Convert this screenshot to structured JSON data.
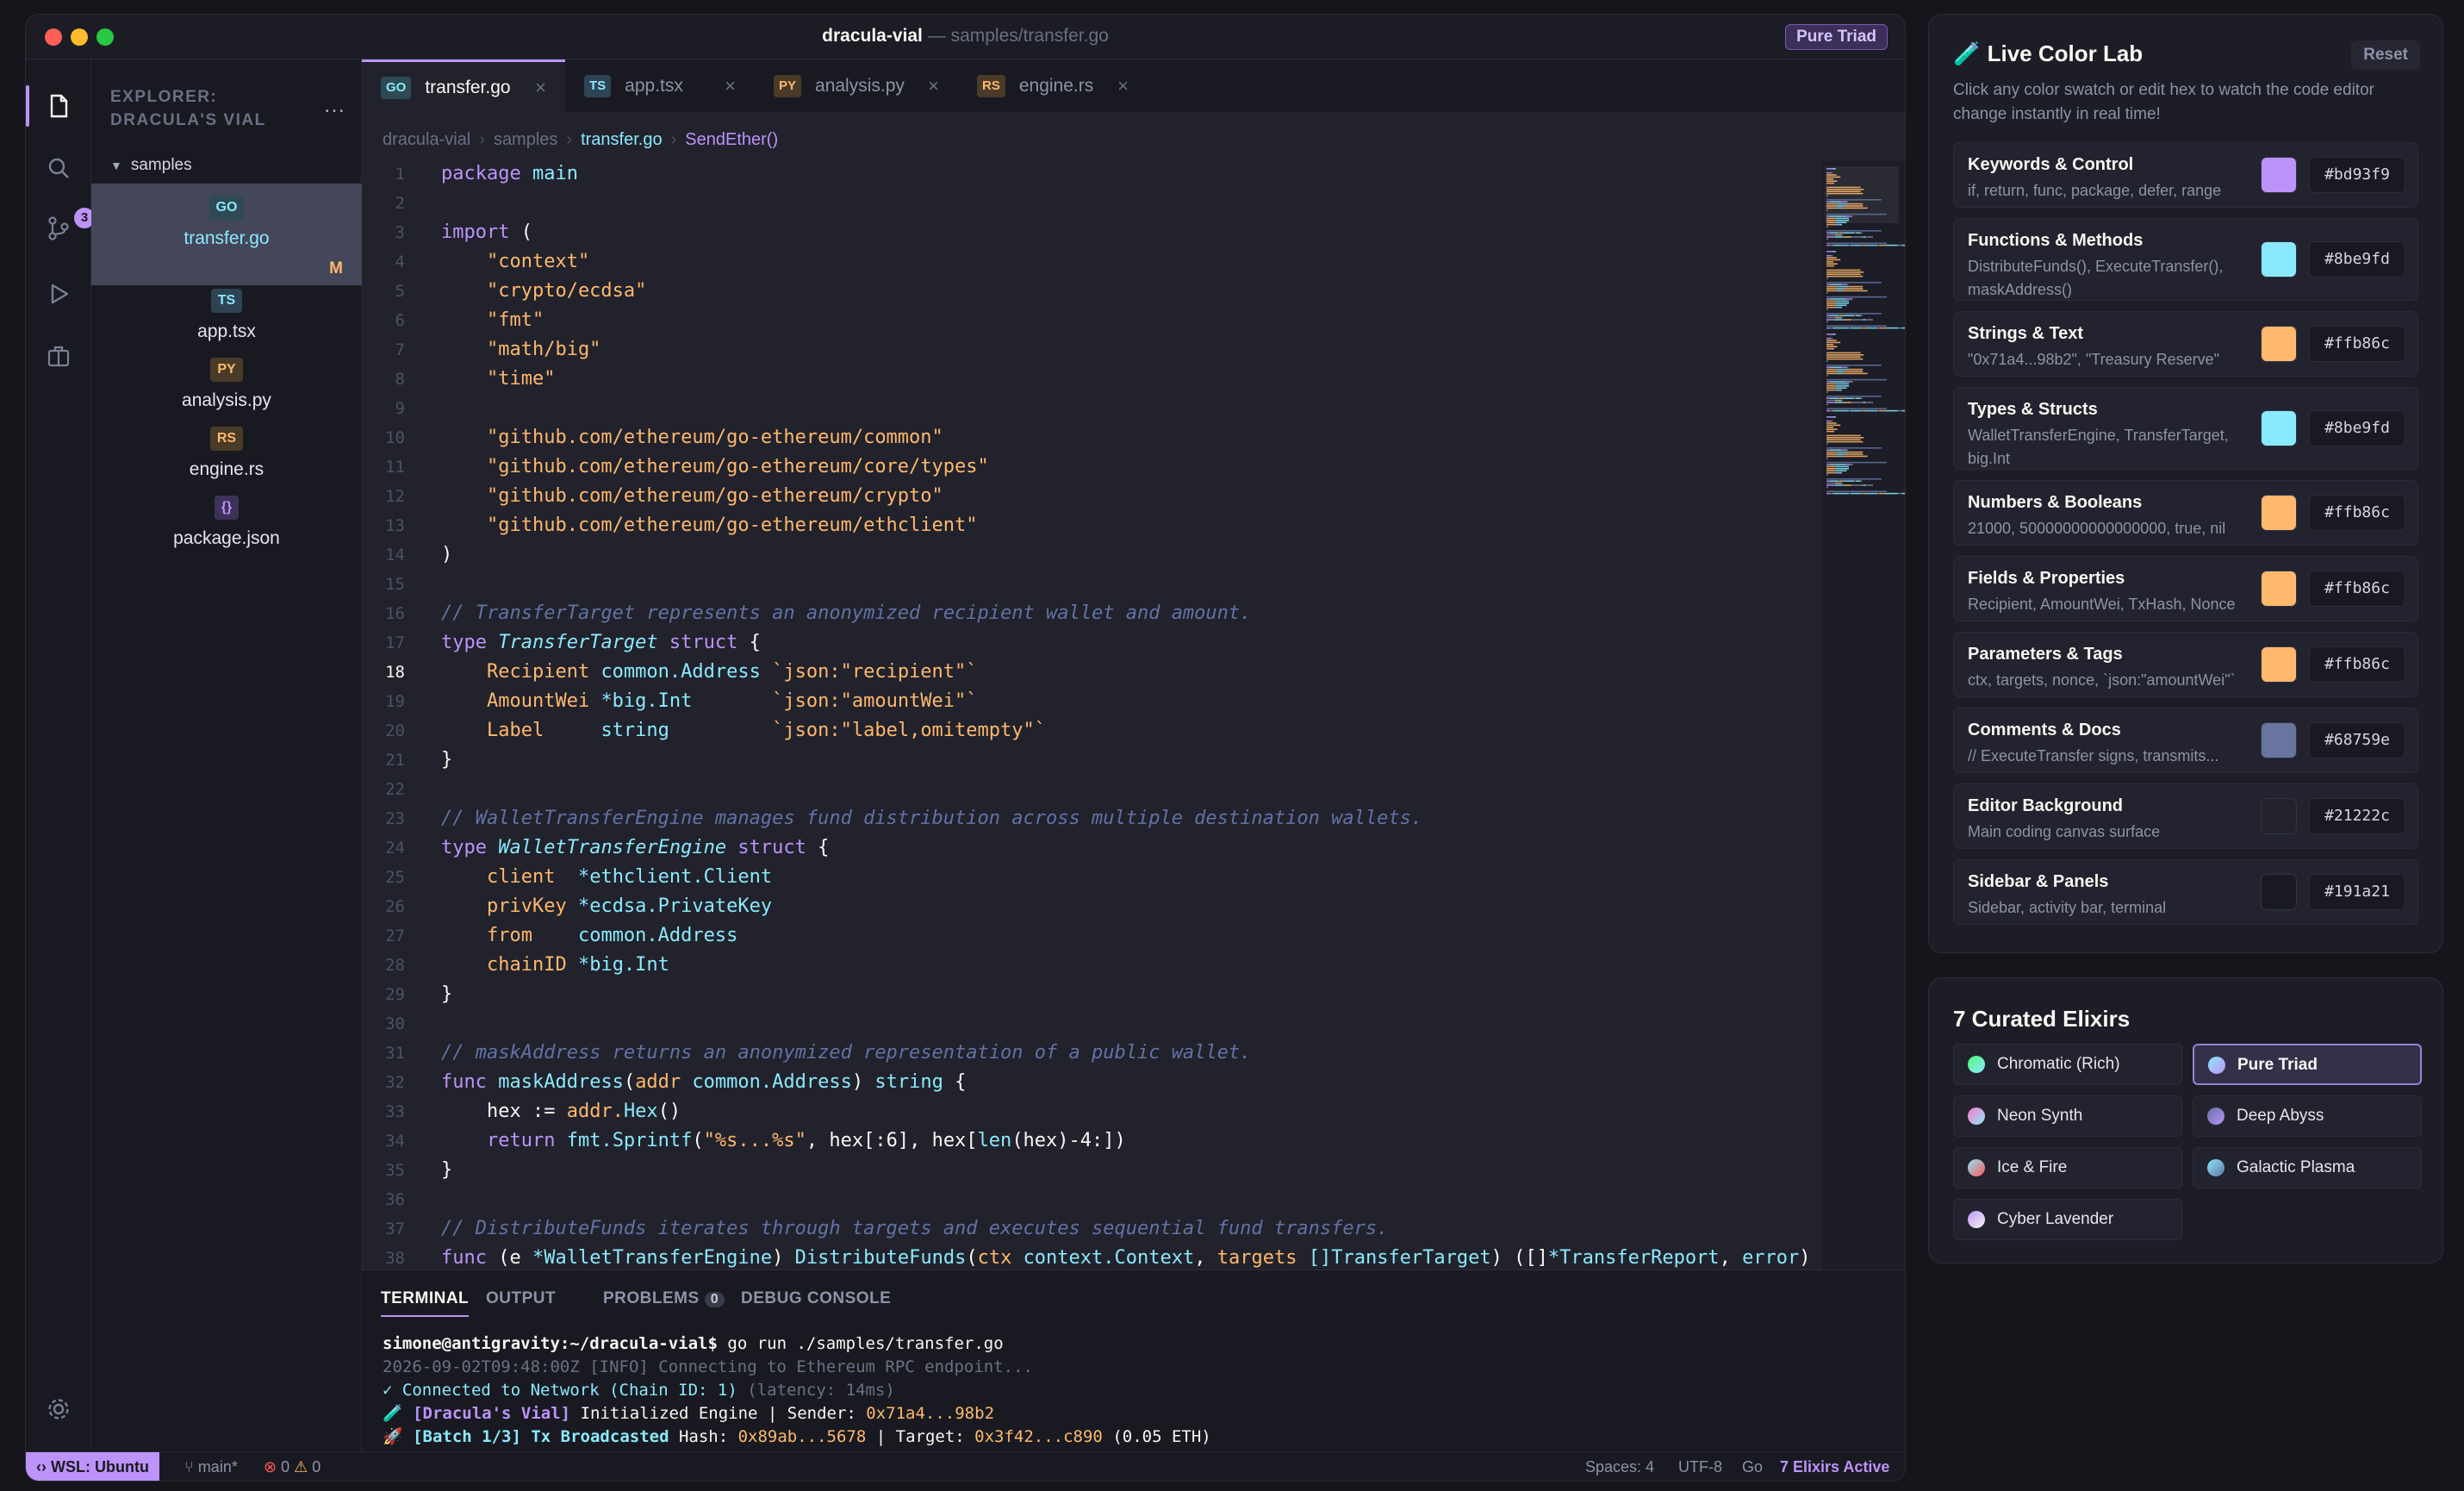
{
  "window": {
    "app": "dracula-vial",
    "sep": " — ",
    "path": "samples/transfer.go",
    "theme_badge": "Pure Triad"
  },
  "activity": {
    "scm_count": "3"
  },
  "explorer": {
    "title": "EXPLORER: DRACULA'S VIAL",
    "more": "…",
    "folder": "samples",
    "files": [
      {
        "badge": "GO",
        "name": "transfer.go",
        "modified": "M"
      },
      {
        "badge": "TS",
        "name": "app.tsx"
      },
      {
        "badge": "PY",
        "name": "analysis.py"
      },
      {
        "badge": "RS",
        "name": "engine.rs"
      },
      {
        "badge": "{}",
        "name": "package.json"
      }
    ]
  },
  "tabs": [
    {
      "badge": "GO",
      "label": "transfer.go"
    },
    {
      "badge": "TS",
      "label": "app.tsx"
    },
    {
      "badge": "PY",
      "label": "analysis.py"
    },
    {
      "badge": "RS",
      "label": "engine.rs"
    }
  ],
  "tab_close": "×",
  "breadcrumb": [
    "dracula-vial",
    "samples",
    "transfer.go",
    "SendEther()"
  ],
  "breadcrumb_sep": "›",
  "editor": {
    "current_line": 18
  },
  "panel": {
    "tabs": [
      "TERMINAL",
      "OUTPUT",
      "PROBLEMS",
      "DEBUG CONSOLE"
    ],
    "problems_count": "0",
    "prompt_user": "simone@antigravity:~/dracula-vial$",
    "prompt_cmd": " go run ./samples/transfer.go",
    "log_info": "2026-09-02T09:48:00Z [INFO] Connecting to Ethereum RPC endpoint...",
    "log_connected": "✓ Connected to Network (Chain ID: 1)",
    "log_latency": " (latency: 14ms)",
    "log_engine_tag": "🧪 [Dracula's Vial]",
    "log_engine_text": " Initialized Engine | Sender: ",
    "log_engine_addr": "0x71a4...98b2",
    "log_batch_tag": "🚀 [Batch 1/3] Tx Broadcasted",
    "log_batch_hash_label": " Hash: ",
    "log_batch_hash": "0x89ab...5678",
    "log_batch_target_label": " | Target: ",
    "log_batch_target": "0x3f42...c890",
    "log_batch_amount": " (0.05 ETH)"
  },
  "status": {
    "remote": "WSL: Ubuntu",
    "branch": "main*",
    "errors": "0",
    "warnings": "0",
    "spaces": "Spaces: 4",
    "encoding": "UTF-8",
    "language": "Go",
    "elixirs": "7 Elixirs Active"
  },
  "color_lab": {
    "title": "Live Color Lab",
    "reset": "Reset",
    "description": "Click any color swatch or edit hex to watch the code editor change instantly in real time!",
    "rows": [
      {
        "name": "Keywords & Control",
        "desc": "if, return, func, package, defer, range",
        "hex": "#bd93f9"
      },
      {
        "name": "Functions & Methods",
        "desc": "DistributeFunds(), ExecuteTransfer(), maskAddress()",
        "hex": "#8be9fd"
      },
      {
        "name": "Strings & Text",
        "desc": "\"0x71a4...98b2\", \"Treasury Reserve\"",
        "hex": "#ffb86c"
      },
      {
        "name": "Types & Structs",
        "desc": "WalletTransferEngine, TransferTarget, big.Int",
        "hex": "#8be9fd"
      },
      {
        "name": "Numbers & Booleans",
        "desc": "21000, 50000000000000000, true, nil",
        "hex": "#ffb86c"
      },
      {
        "name": "Fields & Properties",
        "desc": "Recipient, AmountWei, TxHash, Nonce",
        "hex": "#ffb86c"
      },
      {
        "name": "Parameters & Tags",
        "desc": "ctx, targets, nonce, `json:\"amountWei\"`",
        "hex": "#ffb86c"
      },
      {
        "name": "Comments & Docs",
        "desc": "// ExecuteTransfer signs, transmits...",
        "hex": "#68759e"
      },
      {
        "name": "Editor Background",
        "desc": "Main coding canvas surface",
        "hex": "#21222c"
      },
      {
        "name": "Sidebar & Panels",
        "desc": "Sidebar, activity bar, terminal",
        "hex": "#191a21"
      }
    ]
  },
  "elixirs": {
    "title": "7 Curated Elixirs",
    "items": [
      {
        "label": "Chromatic (Rich)",
        "colors": [
          "#50fa7b",
          "#8be9fd"
        ]
      },
      {
        "label": "Pure Triad",
        "colors": [
          "#8be9fd",
          "#bd93f9"
        ]
      },
      {
        "label": "Neon Synth",
        "colors": [
          "#ff79c6",
          "#8be9fd"
        ]
      },
      {
        "label": "Deep Abyss",
        "colors": [
          "#6272a4",
          "#bd93f9"
        ]
      },
      {
        "label": "Ice & Fire",
        "colors": [
          "#8be9fd",
          "#ff5555"
        ]
      },
      {
        "label": "Galactic Plasma",
        "colors": [
          "#8be9fd",
          "#6272a4"
        ]
      },
      {
        "label": "Cyber Lavender",
        "colors": [
          "#bd93f9",
          "#f8f8f2"
        ]
      }
    ]
  },
  "colors": {
    "keyword": "#bd93f9",
    "function": "#8be9fd",
    "string": "#ffb86c",
    "comment": "#6272a4",
    "bg": "#21222c",
    "sidebar": "#191a21"
  },
  "code_lines": [
    [
      [
        "package ",
        "k"
      ],
      [
        "main",
        "f"
      ]
    ],
    [],
    [
      [
        "import",
        "k"
      ],
      [
        " (",
        ""
      ]
    ],
    [
      [
        "    \"context\"",
        "s"
      ]
    ],
    [
      [
        "    \"crypto/ecdsa\"",
        "s"
      ]
    ],
    [
      [
        "    \"fmt\"",
        "s"
      ]
    ],
    [
      [
        "    \"math/big\"",
        "s"
      ]
    ],
    [
      [
        "    \"time\"",
        "s"
      ]
    ],
    [],
    [
      [
        "    \"github.com/ethereum/go-ethereum/common\"",
        "s"
      ]
    ],
    [
      [
        "    \"github.com/ethereum/go-ethereum/core/types\"",
        "s"
      ]
    ],
    [
      [
        "    \"github.com/ethereum/go-ethereum/crypto\"",
        "s"
      ]
    ],
    [
      [
        "    \"github.com/ethereum/go-ethereum/ethclient\"",
        "s"
      ]
    ],
    [
      [
        ")",
        ""
      ]
    ],
    [],
    [
      [
        "// TransferTarget represents an anonymized recipient wallet and amount.",
        "c"
      ]
    ],
    [
      [
        "type ",
        "k"
      ],
      [
        "TransferTarget",
        "t"
      ],
      [
        " struct",
        "k"
      ],
      [
        " {",
        ""
      ]
    ],
    [
      [
        "    Recipient ",
        "fl"
      ],
      [
        "common.Address",
        "f"
      ],
      [
        " `json:\"recipient\"`",
        "s"
      ]
    ],
    [
      [
        "    AmountWei ",
        "fl"
      ],
      [
        "*big.Int",
        "f"
      ],
      [
        "       `json:\"amountWei\"`",
        "s"
      ]
    ],
    [
      [
        "    Label     ",
        "fl"
      ],
      [
        "string",
        "f"
      ],
      [
        "         `json:\"label,omitempty\"`",
        "s"
      ]
    ],
    [
      [
        "}",
        ""
      ]
    ],
    [],
    [
      [
        "// WalletTransferEngine manages fund distribution across multiple destination wallets.",
        "c"
      ]
    ],
    [
      [
        "type ",
        "k"
      ],
      [
        "WalletTransferEngine",
        "t"
      ],
      [
        " struct",
        "k"
      ],
      [
        " {",
        ""
      ]
    ],
    [
      [
        "    client  ",
        "fl"
      ],
      [
        "*ethclient.Client",
        "f"
      ]
    ],
    [
      [
        "    privKey ",
        "fl"
      ],
      [
        "*ecdsa.PrivateKey",
        "f"
      ]
    ],
    [
      [
        "    from    ",
        "fl"
      ],
      [
        "common.Address",
        "f"
      ]
    ],
    [
      [
        "    chainID ",
        "fl"
      ],
      [
        "*big.Int",
        "f"
      ]
    ],
    [
      [
        "}",
        ""
      ]
    ],
    [],
    [
      [
        "// maskAddress returns an anonymized representation of a public wallet.",
        "c"
      ]
    ],
    [
      [
        "func ",
        "k"
      ],
      [
        "maskAddress",
        "f"
      ],
      [
        "(",
        ""
      ],
      [
        "addr ",
        "p"
      ],
      [
        "common.Address",
        "f"
      ],
      [
        ") ",
        ""
      ],
      [
        "string",
        "f"
      ],
      [
        " {",
        ""
      ]
    ],
    [
      [
        "    hex := ",
        ""
      ],
      [
        "addr.",
        "p"
      ],
      [
        "Hex",
        "f"
      ],
      [
        "()",
        ""
      ]
    ],
    [
      [
        "    return ",
        "k"
      ],
      [
        "fmt.",
        "f"
      ],
      [
        "Sprintf",
        "f"
      ],
      [
        "(",
        ""
      ],
      [
        "\"%s...%s\"",
        "s"
      ],
      [
        ", hex[:6], hex[",
        ""
      ],
      [
        "len",
        "f"
      ],
      [
        "(hex)-4:])",
        ""
      ]
    ],
    [
      [
        "}",
        ""
      ]
    ],
    [],
    [
      [
        "// DistributeFunds iterates through targets and executes sequential fund transfers.",
        "c"
      ]
    ],
    [
      [
        "func ",
        "k"
      ],
      [
        "(e ",
        ""
      ],
      [
        "*WalletTransferEngine",
        "f"
      ],
      [
        ") ",
        ""
      ],
      [
        "DistributeFunds",
        "f"
      ],
      [
        "(",
        ""
      ],
      [
        "ctx ",
        "p"
      ],
      [
        "context.Context",
        "f"
      ],
      [
        ", ",
        ""
      ],
      [
        "targets ",
        "p"
      ],
      [
        "[]TransferTarget",
        "f"
      ],
      [
        ") ([]",
        ""
      ],
      [
        "*TransferReport",
        "f"
      ],
      [
        ", ",
        ""
      ],
      [
        "error",
        "f"
      ],
      [
        ") {",
        ""
      ]
    ],
    [
      [
        ""
      ]
    ]
  ]
}
